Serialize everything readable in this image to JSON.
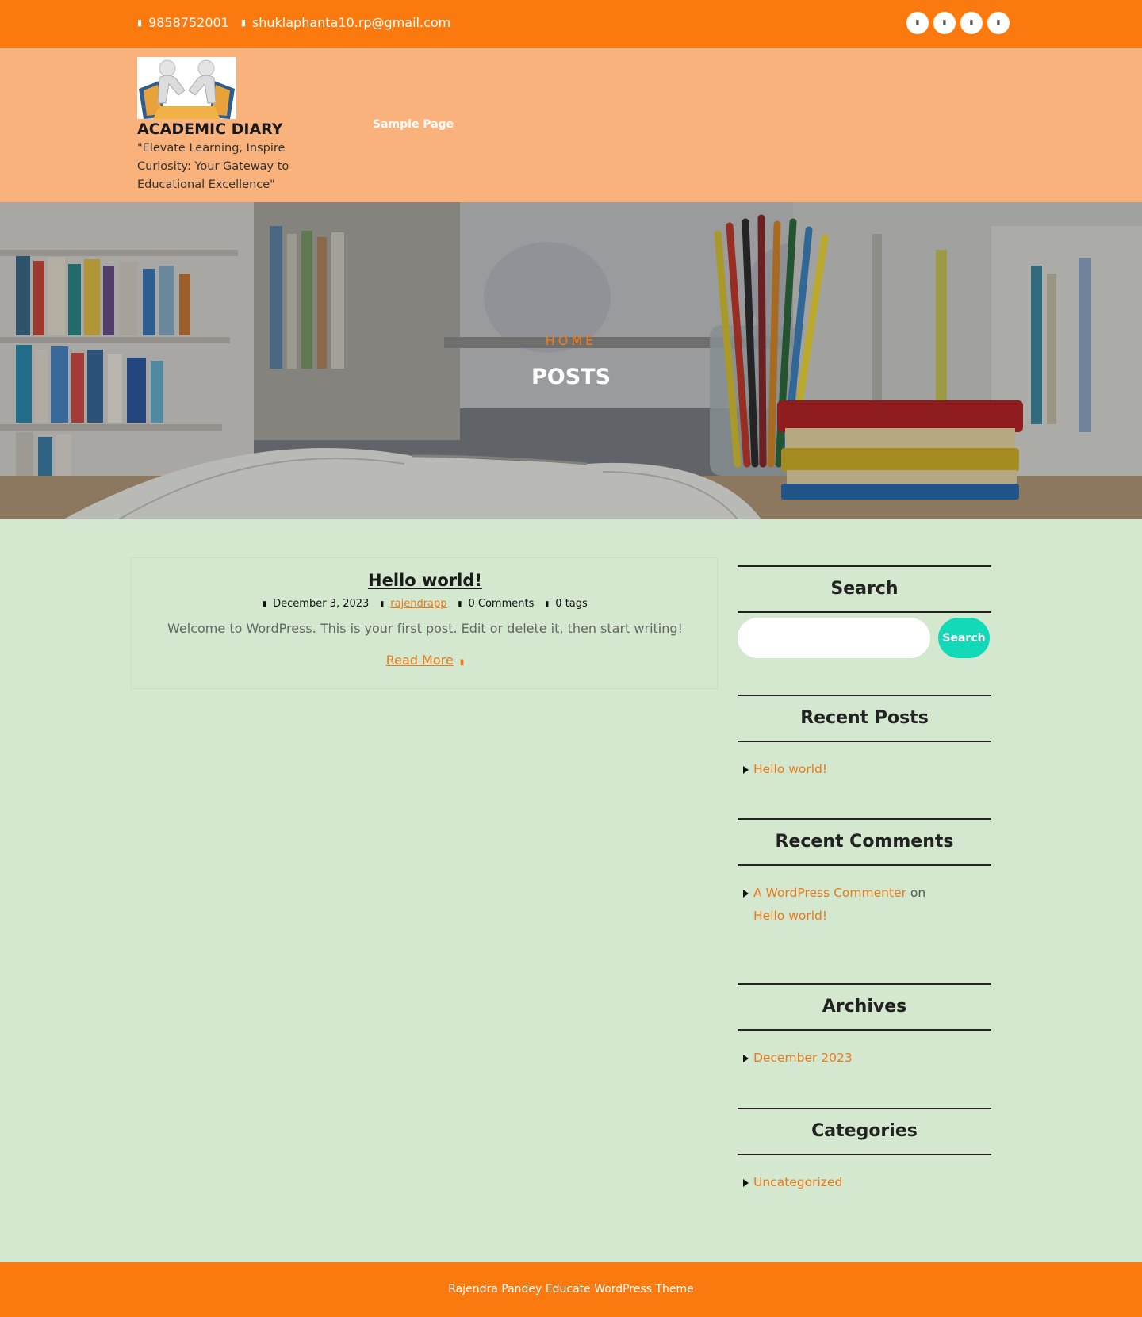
{
  "topbar": {
    "phone": "9858752001",
    "email": "shuklaphanta10.rp@gmail.com",
    "phone_icon": "phone-icon",
    "email_icon": "envelope-icon",
    "social": [
      "facebook-icon",
      "twitter-icon",
      "instagram-icon",
      "linkedin-icon"
    ]
  },
  "header": {
    "site_title": "ACADEMIC DIARY",
    "tagline": "\"Elevate Learning, Inspire Curiosity: Your Gateway to Educational Excellence\"",
    "nav": [
      "Sample Page"
    ]
  },
  "hero": {
    "breadcrumb": "HOME",
    "title": "POSTS"
  },
  "post": {
    "title": "Hello world!",
    "date": "December 3, 2023",
    "author": "rajendrapp",
    "comments": "0 Comments",
    "tags": "0 tags",
    "excerpt": "Welcome to WordPress. This is your first post. Edit or delete it, then start writing!",
    "read_more": "Read More"
  },
  "sidebar": {
    "search": {
      "title": "Search",
      "button": "Search",
      "placeholder": ""
    },
    "recent_posts": {
      "title": "Recent Posts",
      "items": [
        "Hello world!"
      ]
    },
    "recent_comments": {
      "title": "Recent Comments",
      "author": "A WordPress Commenter",
      "on": "on",
      "post": "Hello world!"
    },
    "archives": {
      "title": "Archives",
      "items": [
        "December 2023"
      ]
    },
    "categories": {
      "title": "Categories",
      "items": [
        "Uncategorized"
      ]
    }
  },
  "footer": {
    "text": "Rajendra Pandey Educate WordPress Theme"
  },
  "colors": {
    "brand_orange": "#fb7a10",
    "header_peach": "#fab27d",
    "page_green": "#d4e8cf",
    "search_button": "#12dab9",
    "link_orange": "#e87a1c"
  }
}
